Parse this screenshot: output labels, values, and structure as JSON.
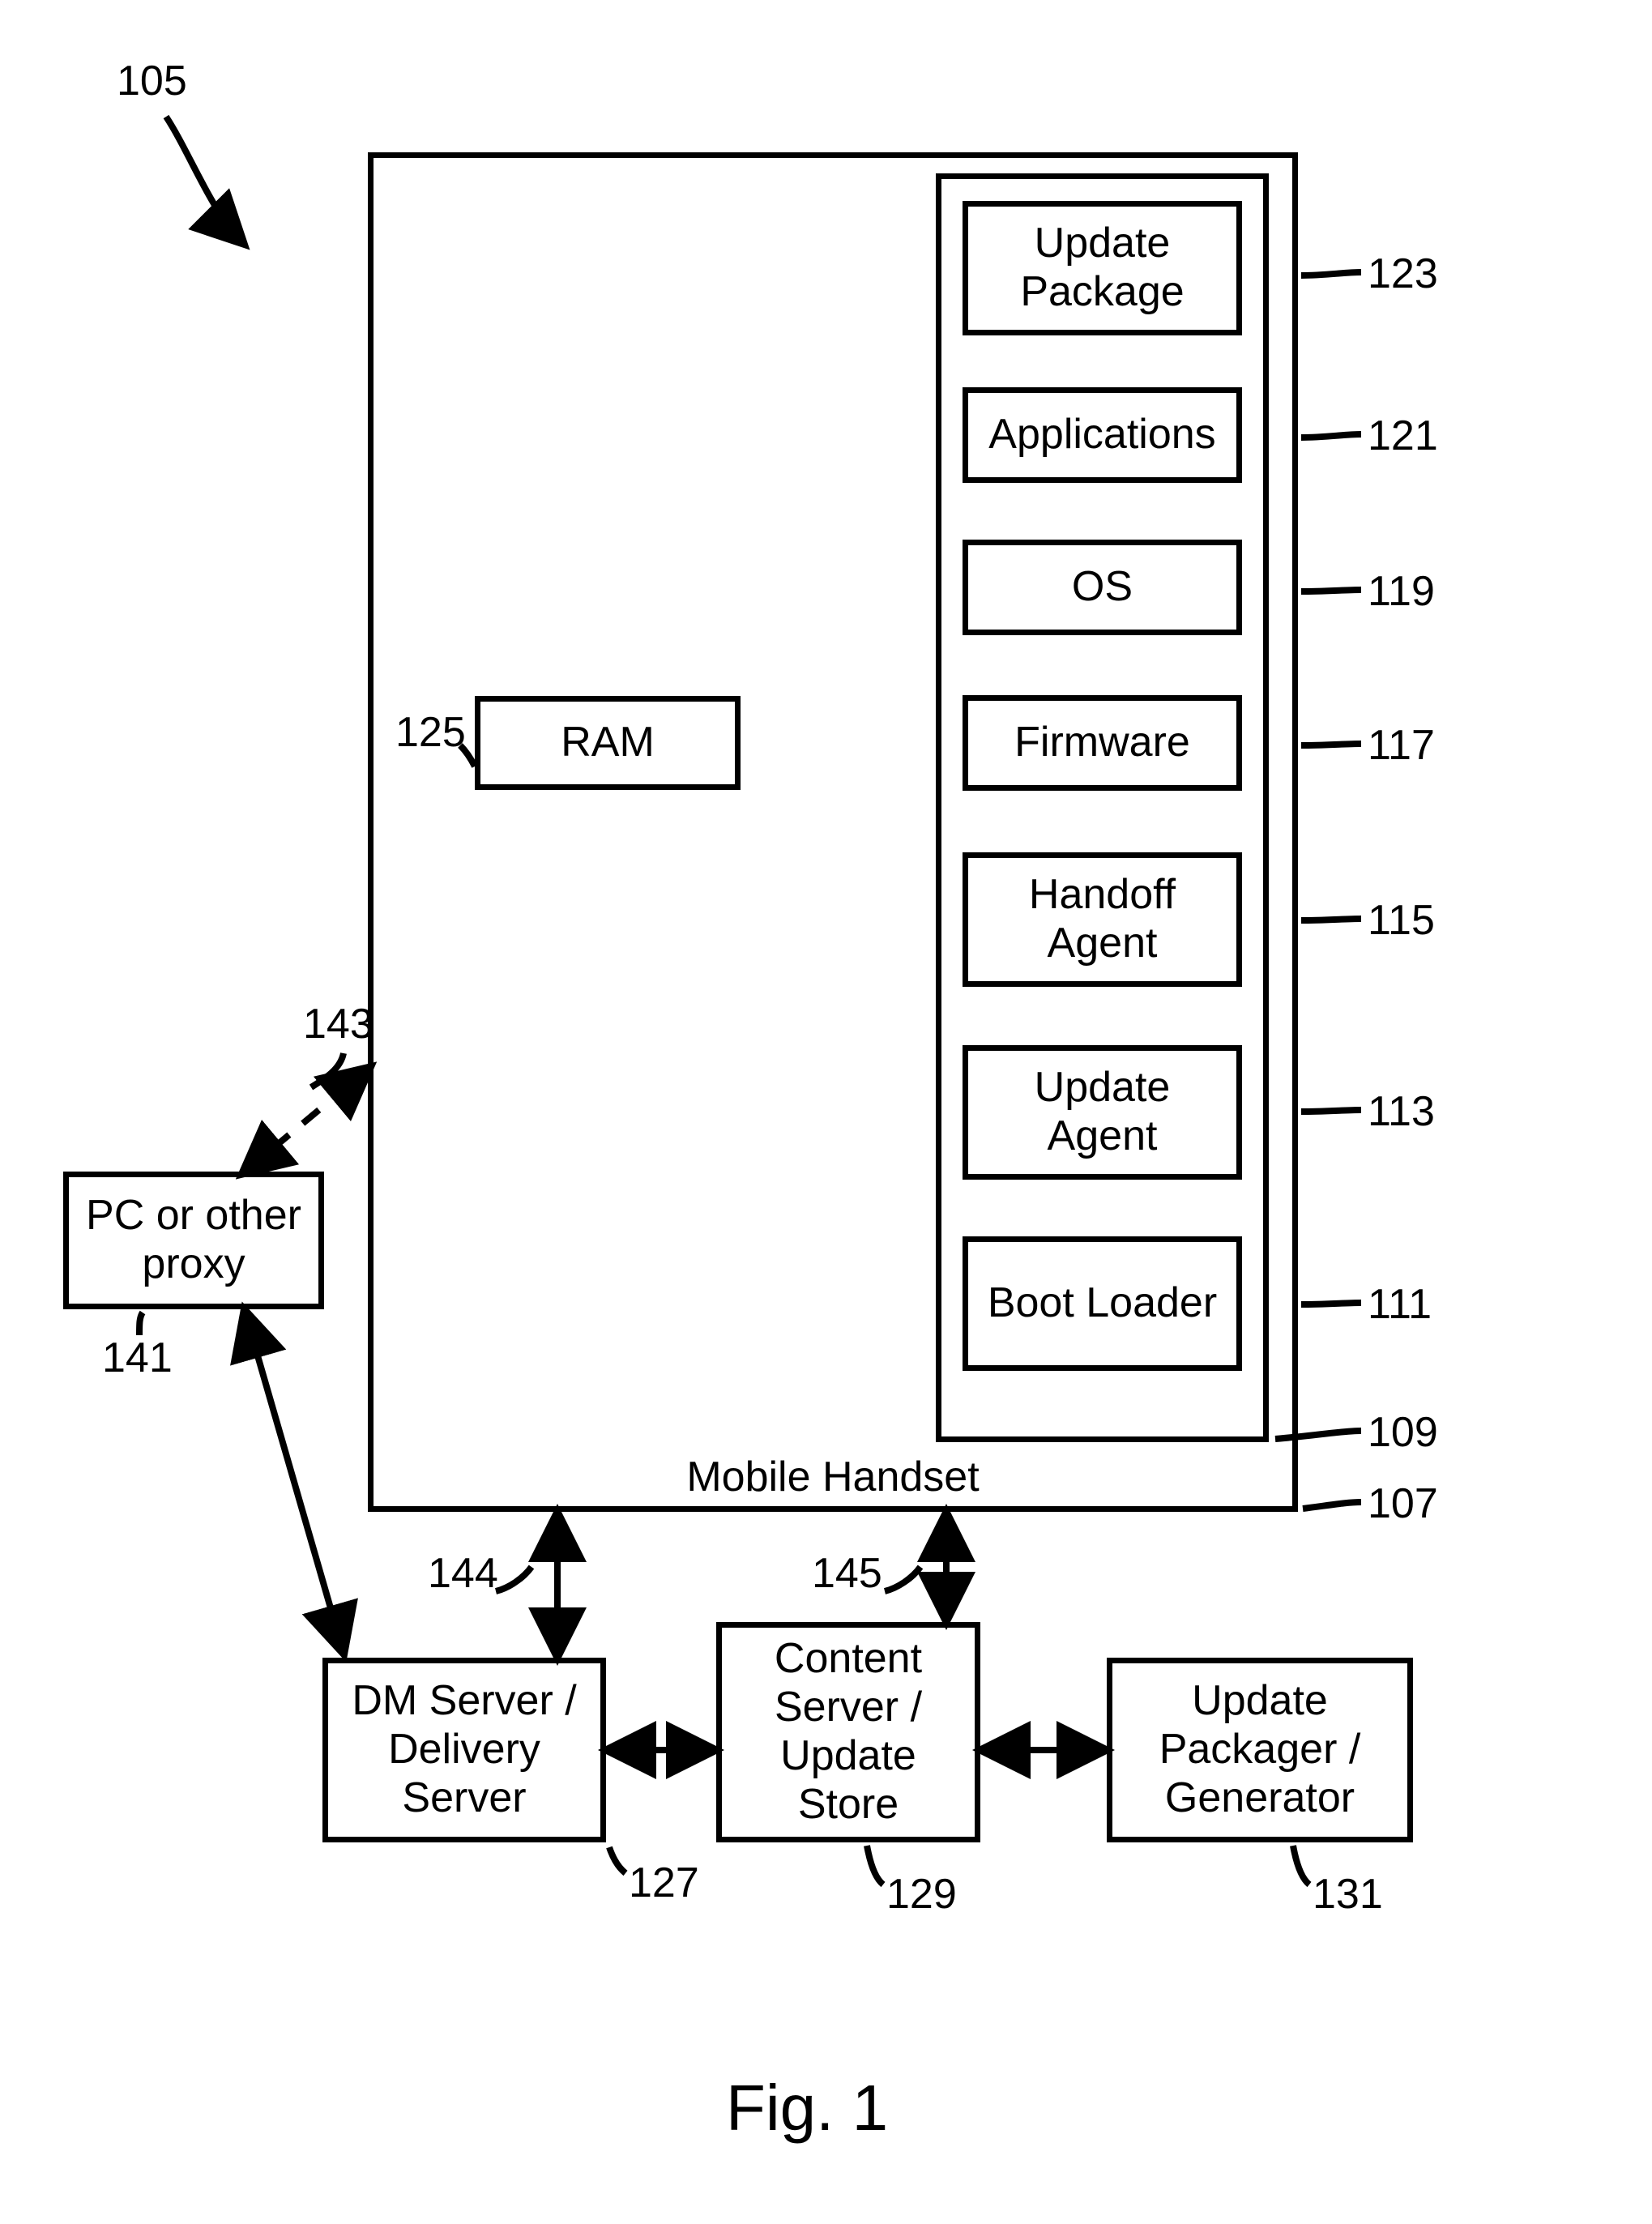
{
  "figure": {
    "caption": "Fig. 1",
    "system_ref": "105"
  },
  "handset": {
    "label": "Mobile Handset",
    "ref_outer": "107",
    "ref_inner": "109",
    "ram": {
      "label": "RAM",
      "ref": "125"
    },
    "stack": {
      "update_package": {
        "label": "Update Package",
        "ref": "123"
      },
      "applications": {
        "label": "Applications",
        "ref": "121"
      },
      "os": {
        "label": "OS",
        "ref": "119"
      },
      "firmware": {
        "label": "Firmware",
        "ref": "117"
      },
      "handoff_agent": {
        "label": "Handoff Agent",
        "ref": "115"
      },
      "update_agent": {
        "label": "Update Agent",
        "ref": "113"
      },
      "boot_loader": {
        "label": "Boot Loader",
        "ref": "111"
      }
    }
  },
  "proxy": {
    "label": "PC or other proxy",
    "ref": "141"
  },
  "dm_server": {
    "label": "DM Server / Delivery Server",
    "ref": "127"
  },
  "content_server": {
    "label": "Content Server / Update Store",
    "ref": "129"
  },
  "update_packager": {
    "label": "Update Packager / Generator",
    "ref": "131"
  },
  "links": {
    "proxy_wireless": "143",
    "dm_handset": "144",
    "content_handset": "145"
  }
}
